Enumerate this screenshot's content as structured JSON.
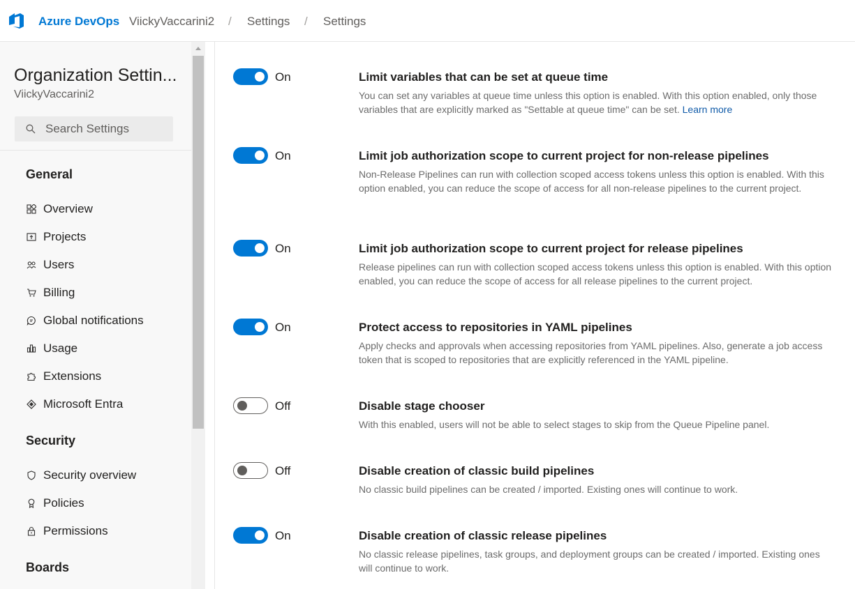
{
  "header": {
    "brand": "Azure DevOps",
    "breadcrumbs": [
      "ViickyVaccarini2",
      "Settings",
      "Settings"
    ],
    "separator": "/"
  },
  "sidebar": {
    "title": "Organization Settin...",
    "subtitle": "ViickyVaccarini2",
    "search_placeholder": "Search Settings",
    "sections": [
      {
        "heading": "General",
        "items": [
          {
            "label": "Overview",
            "icon": "overview-icon"
          },
          {
            "label": "Projects",
            "icon": "projects-icon"
          },
          {
            "label": "Users",
            "icon": "users-icon"
          },
          {
            "label": "Billing",
            "icon": "cart-icon"
          },
          {
            "label": "Global notifications",
            "icon": "chat-icon"
          },
          {
            "label": "Usage",
            "icon": "usage-icon"
          },
          {
            "label": "Extensions",
            "icon": "puzzle-icon"
          },
          {
            "label": "Microsoft Entra",
            "icon": "entra-icon"
          }
        ]
      },
      {
        "heading": "Security",
        "items": [
          {
            "label": "Security overview",
            "icon": "shield-icon"
          },
          {
            "label": "Policies",
            "icon": "ribbon-icon"
          },
          {
            "label": "Permissions",
            "icon": "lock-icon"
          }
        ]
      },
      {
        "heading": "Boards",
        "items": []
      }
    ]
  },
  "settings": [
    {
      "state": "On",
      "enabled": true,
      "title": "Limit variables that can be set at queue time",
      "description": "You can set any variables at queue time unless this option is enabled. With this option enabled, only those variables that are explicitly marked as \"Settable at queue time\" can be set.",
      "link": "Learn more"
    },
    {
      "state": "On",
      "enabled": true,
      "title": "Limit job authorization scope to current project for non-release pipelines",
      "description": "Non-Release Pipelines can run with collection scoped access tokens unless this option is enabled. With this option enabled, you can reduce the scope of access for all non-release pipelines to the current project."
    },
    {
      "state": "On",
      "enabled": true,
      "title": "Limit job authorization scope to current project for release pipelines",
      "description": "Release pipelines can run with collection scoped access tokens unless this option is enabled. With this option enabled, you can reduce the scope of access for all release pipelines to the current project."
    },
    {
      "state": "On",
      "enabled": true,
      "title": "Protect access to repositories in YAML pipelines",
      "description": "Apply checks and approvals when accessing repositories from YAML pipelines. Also, generate a job access token that is scoped to repositories that are explicitly referenced in the YAML pipeline."
    },
    {
      "state": "Off",
      "enabled": false,
      "title": "Disable stage chooser",
      "description": "With this enabled, users will not be able to select stages to skip from the Queue Pipeline panel."
    },
    {
      "state": "Off",
      "enabled": false,
      "title": "Disable creation of classic build pipelines",
      "description": "No classic build pipelines can be created / imported. Existing ones will continue to work."
    },
    {
      "state": "On",
      "enabled": true,
      "title": "Disable creation of classic release pipelines",
      "description": "No classic release pipelines, task groups, and deployment groups can be created / imported. Existing ones will continue to work."
    }
  ],
  "colors": {
    "accent": "#0078d4",
    "sidebar_bg": "#f8f8f8"
  }
}
